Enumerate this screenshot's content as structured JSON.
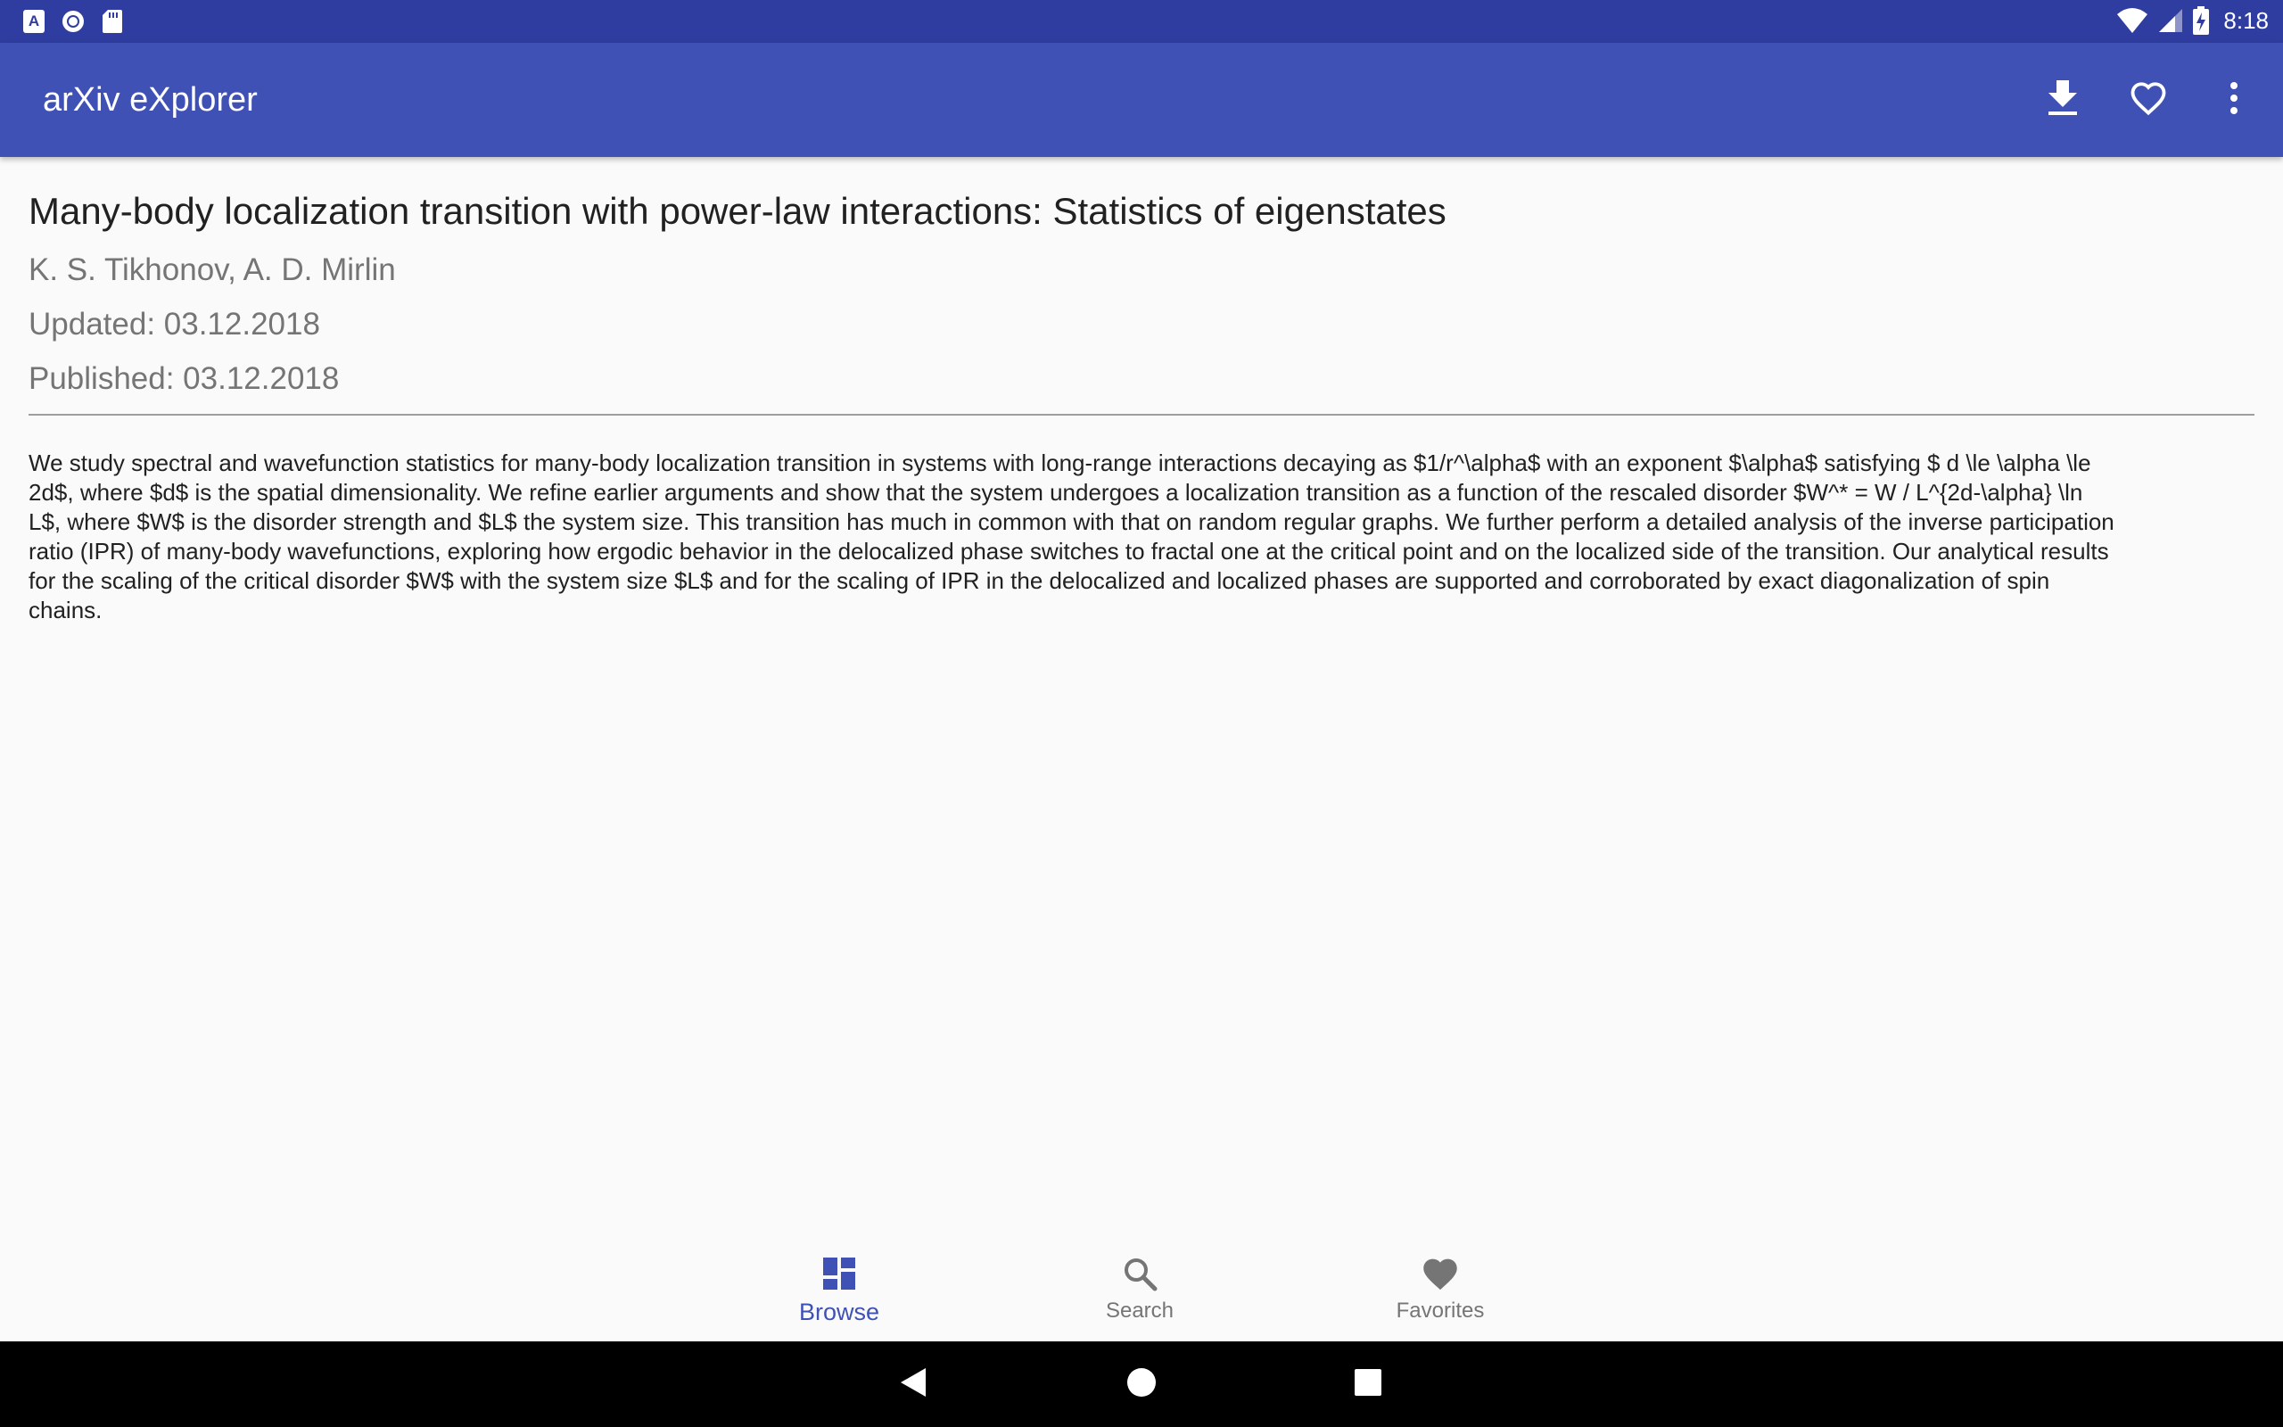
{
  "status_bar": {
    "time": "8:18",
    "icons": [
      "a-notification-icon",
      "circle-notification-icon",
      "sd-card-icon",
      "wifi-icon",
      "signal-icon",
      "battery-charging-icon"
    ]
  },
  "app_bar": {
    "title": "arXiv eXplorer",
    "actions": [
      "download-icon",
      "favorite-outline-icon",
      "more-vert-icon"
    ]
  },
  "paper": {
    "title": "Many-body localization transition with power-law interactions: Statistics of eigenstates",
    "authors": "K. S. Tikhonov, A. D. Mirlin",
    "updated": "Updated: 03.12.2018",
    "published": "Published: 03.12.2018",
    "abstract": "We study spectral and wavefunction statistics for many-body localization transition in systems with long-range interactions decaying as $1/r^\\alpha$ with an exponent $\\alpha$ satisfying $ d \\le \\alpha \\le 2d$, where $d$ is the spatial dimensionality. We refine earlier arguments and show that the system undergoes a localization transition as a function of the rescaled disorder $W^* = W / L^{2d-\\alpha} \\ln L$, where $W$ is the disorder strength and $L$ the system size. This transition has much in common with that on random regular graphs. We further perform a detailed analysis of the inverse participation ratio (IPR) of many-body wavefunctions, exploring how ergodic behavior in the delocalized phase switches to fractal one at the critical point and on the localized side of the transition. Our analytical results for the scaling of the critical disorder $W$ with the system size $L$ and for the scaling of IPR in the delocalized and localized phases are supported and corroborated by exact diagonalization of spin chains."
  },
  "bottom_nav": {
    "items": [
      {
        "label": "Browse",
        "icon": "dashboard-icon",
        "active": true
      },
      {
        "label": "Search",
        "icon": "search-icon",
        "active": false
      },
      {
        "label": "Favorites",
        "icon": "heart-icon",
        "active": false
      }
    ]
  },
  "colors": {
    "status_bar": "#2f3da0",
    "app_bar": "#3f51b5",
    "accent_active": "#3f51b5",
    "inactive": "#757575"
  }
}
